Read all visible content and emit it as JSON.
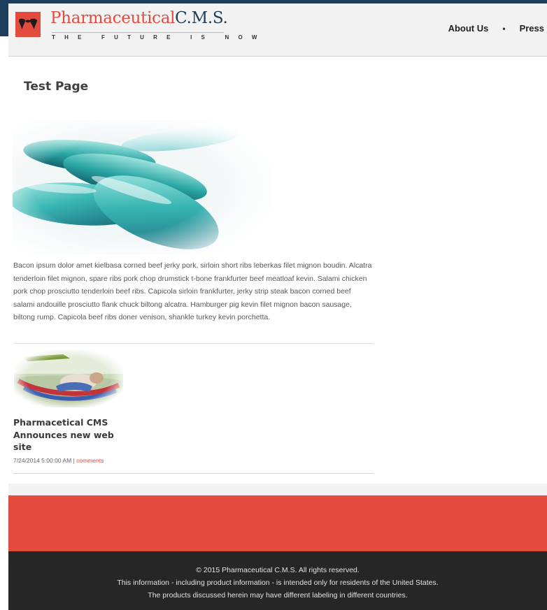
{
  "brand": {
    "name_part1": "Pharmaceutical",
    "name_part2": "C.M.S.",
    "tagline": "THE FUTURE IS NOW",
    "primary_color": "#e34b3f",
    "secondary_color": "#1c3e5a",
    "logo_icon": "pill-drops-icon"
  },
  "nav": {
    "items": [
      {
        "label": "About Us"
      },
      {
        "label": "Press"
      }
    ],
    "separator": "•"
  },
  "page": {
    "title": "Test Page",
    "hero_image": "capsules-image",
    "body": "Bacon ipsum dolor amet kielbasa corned beef jerky pork, sirloin short ribs leberkas filet mignon boudin. Alcatra tenderloin filet mignon, spare ribs pork chop drumstick t-bone frankfurter beef meatloaf kevin. Salami chicken pork chop prosciutto tenderloin beef ribs. Capicola sirloin frankfurter, jerky strip steak bacon corned beef salami andouille prosciutto flank chuck biltong alcatra. Hamburger pig kevin filet mignon bacon sausage, biltong rump. Capicola beef ribs doner venison, shankle turkey kevin porchetta."
  },
  "news": {
    "thumbnail": "hammock-image",
    "title": "Pharmacetical CMS Announces new web site",
    "date": "7/24/2014 5:00:00 AM",
    "divider": "|",
    "comments_label": "comments"
  },
  "footer": {
    "copyright": "© 2015 Pharmaceutical C.M.S. All rights reserved.",
    "line2": "This information - including product information - is intended only for residents of the United States.",
    "line3": "The products discussed herein may have different labeling in different countries.",
    "band_color": "#e34b3f",
    "bg_color": "#262626"
  }
}
